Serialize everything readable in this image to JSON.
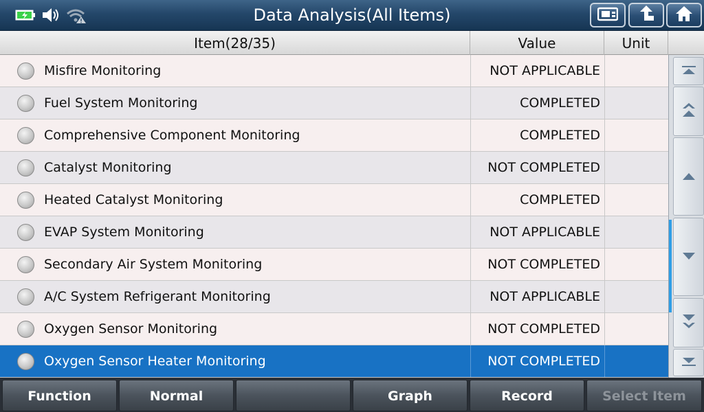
{
  "header": {
    "title": "Data Analysis(All Items)",
    "status_icons": [
      "battery-charging-icon",
      "speaker-icon",
      "wifi-warning-icon"
    ],
    "buttons": [
      "screenshot-icon",
      "back-icon",
      "home-icon"
    ]
  },
  "table": {
    "columns": {
      "item": "Item(28/35)",
      "value": "Value",
      "unit": "Unit"
    },
    "rows": [
      {
        "item": "Misfire Monitoring",
        "value": "NOT APPLICABLE",
        "unit": ""
      },
      {
        "item": "Fuel System Monitoring",
        "value": "COMPLETED",
        "unit": ""
      },
      {
        "item": "Comprehensive Component Monitoring",
        "value": "COMPLETED",
        "unit": ""
      },
      {
        "item": "Catalyst Monitoring",
        "value": "NOT COMPLETED",
        "unit": ""
      },
      {
        "item": "Heated Catalyst Monitoring",
        "value": "COMPLETED",
        "unit": ""
      },
      {
        "item": "EVAP System Monitoring",
        "value": "NOT APPLICABLE",
        "unit": ""
      },
      {
        "item": "Secondary Air System Monitoring",
        "value": "NOT COMPLETED",
        "unit": ""
      },
      {
        "item": "A/C System Refrigerant Monitoring",
        "value": "NOT APPLICABLE",
        "unit": ""
      },
      {
        "item": "Oxygen Sensor Monitoring",
        "value": "NOT COMPLETED",
        "unit": ""
      },
      {
        "item": "Oxygen Sensor Heater Monitoring",
        "value": "NOT COMPLETED",
        "unit": ""
      }
    ],
    "selected_index": 9
  },
  "scrollbar": {
    "buttons": [
      "scroll-top-icon",
      "page-up-icon",
      "line-up-icon",
      "line-down-icon",
      "page-down-icon",
      "scroll-bottom-icon"
    ]
  },
  "footer": {
    "function": "Function",
    "normal": "Normal",
    "empty": "",
    "graph": "Graph",
    "record": "Record",
    "select_item": "Select Item"
  },
  "colors": {
    "titlebar": "#24476a",
    "selected_row": "#1872c4",
    "scroll_thumb": "#2f9ee6",
    "battery": "#3bd14a"
  }
}
